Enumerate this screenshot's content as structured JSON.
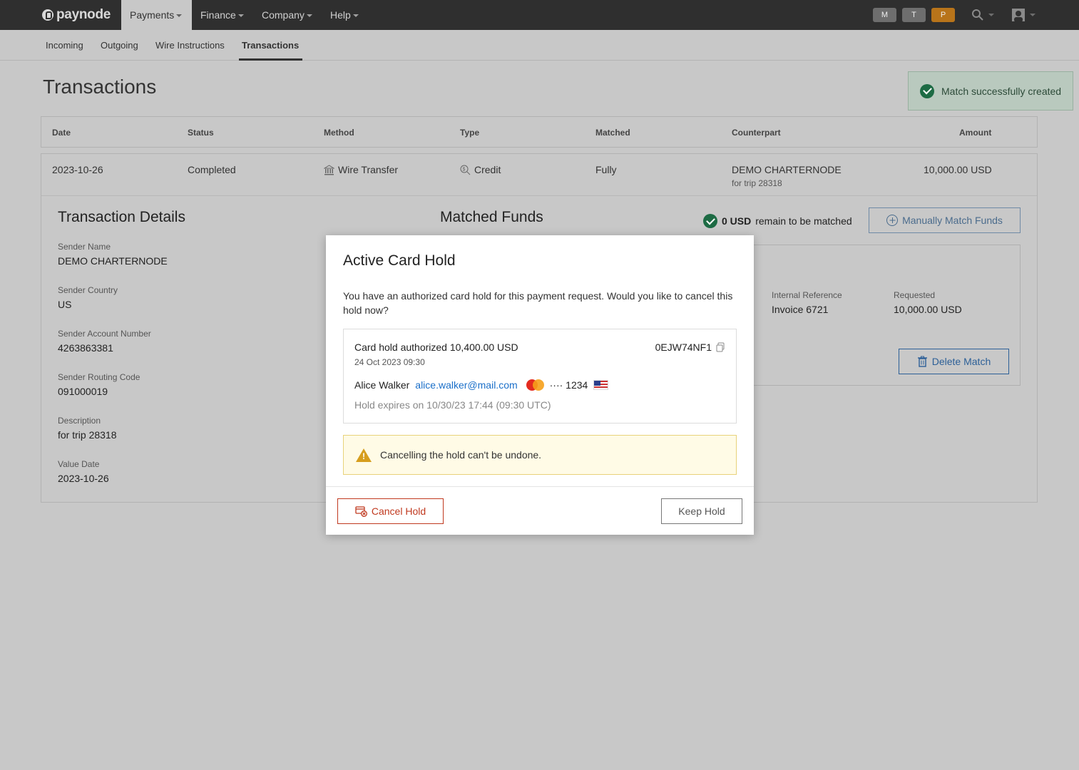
{
  "app": {
    "logo": "paynode"
  },
  "topnav": {
    "items": [
      {
        "label": "Payments"
      },
      {
        "label": "Finance"
      },
      {
        "label": "Company"
      },
      {
        "label": "Help"
      }
    ],
    "chips": [
      {
        "label": "M",
        "color": "#6e6e6e"
      },
      {
        "label": "T",
        "color": "#6e6e6e"
      },
      {
        "label": "P",
        "color": "#b8741a"
      }
    ]
  },
  "subnav": {
    "items": [
      {
        "label": "Incoming"
      },
      {
        "label": "Outgoing"
      },
      {
        "label": "Wire Instructions"
      },
      {
        "label": "Transactions"
      }
    ]
  },
  "page": {
    "title": "Transactions"
  },
  "toast": {
    "message": "Match successfully created"
  },
  "table": {
    "headers": [
      "Date",
      "Status",
      "Method",
      "Type",
      "Matched",
      "Counterpart",
      "Amount"
    ],
    "row": {
      "date": "2023-10-26",
      "status": "Completed",
      "method": "Wire Transfer",
      "type": "Credit",
      "matched": "Fully",
      "counterpart": "DEMO CHARTERNODE",
      "counterpart_sub": "for trip 28318",
      "amount": "10,000.00 USD"
    }
  },
  "details": {
    "title": "Transaction Details",
    "fields": [
      {
        "label": "Sender Name",
        "value": "DEMO CHARTERNODE"
      },
      {
        "label": "Sender Country",
        "value": "US"
      },
      {
        "label": "Sender Account Number",
        "value": "4263863381"
      },
      {
        "label": "Sender Routing Code",
        "value": "091000019"
      },
      {
        "label": "Description",
        "value": "for trip 28318"
      },
      {
        "label": "Value Date",
        "value": "2023-10-26"
      }
    ]
  },
  "matched": {
    "title": "Matched Funds",
    "remain_amount": "0 USD",
    "remain_text": "remain to be matched",
    "manual_button": "Manually Match Funds",
    "internal_ref_label": "Internal Reference",
    "internal_ref_value": "Invoice 6721",
    "requested_label": "Requested",
    "requested_value": "10,000.00 USD",
    "delete_button": "Delete Match"
  },
  "modal": {
    "title": "Active Card Hold",
    "message": "You have an authorized card hold for this payment request. Would you like to cancel this hold now?",
    "hold": {
      "title": "Card hold authorized 10,400.00 USD",
      "date": "24 Oct 2023 09:30",
      "reference": "0EJW74NF1",
      "holder": "Alice Walker",
      "email": "alice.walker@mail.com",
      "card_mask": "···· 1234",
      "expires": "Hold expires on 10/30/23 17:44 (09:30 UTC)"
    },
    "warning": "Cancelling the hold can't be undone.",
    "cancel_button": "Cancel Hold",
    "keep_button": "Keep Hold"
  }
}
